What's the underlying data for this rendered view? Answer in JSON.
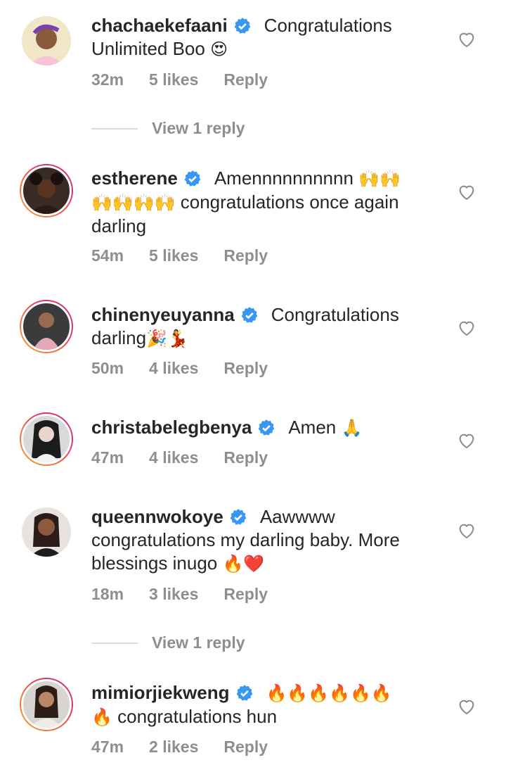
{
  "comments": [
    {
      "username": "chachaekefaani",
      "text": "Congratulations Unlimited Boo",
      "emoji": "😍",
      "time": "32m",
      "likes": "5 likes",
      "reply": "Reply",
      "skin": "#8a5a3c",
      "bg": "#f2e6c8"
    },
    {
      "username": "estherene",
      "text_pre": "Amennnnnnnnnn",
      "emoji_a": "🙌🙌",
      "emoji_b": "🙌🙌🙌🙌",
      "text": "congratulations once again darling",
      "time": "54m",
      "likes": "5 likes",
      "reply": "Reply",
      "skin": "#5a3422",
      "bg": "#3a2a24"
    },
    {
      "username": "chinenyeuyanna",
      "text": "Congratulations darling",
      "emoji": "🎉💃",
      "time": "50m",
      "likes": "4 likes",
      "reply": "Reply",
      "skin": "#9a6a50",
      "bg": "#3b3a3c"
    },
    {
      "username": "christabelegbenya",
      "text": "Amen",
      "emoji": "🙏",
      "time": "47m",
      "likes": "4 likes",
      "reply": "Reply",
      "skin": "#e9d6cc",
      "bg": "#d9d9dc"
    },
    {
      "username": "queennwokoye",
      "text": "Aawwww congratulations my darling baby. More blessings inugo",
      "emoji": "🔥❤️",
      "time": "18m",
      "likes": "3 likes",
      "reply": "Reply",
      "skin": "#8e5a3e",
      "bg": "#e8e3de"
    },
    {
      "username": "mimiorjiekweng",
      "emoji_a": "🔥🔥🔥🔥🔥🔥",
      "emoji_b": "🔥",
      "text": "congratulations hun",
      "time": "47m",
      "likes": "2 likes",
      "reply": "Reply",
      "skin": "#b98668",
      "bg": "#d8d4cf"
    }
  ],
  "view_replies": [
    "View 1 reply",
    "View 1 reply"
  ],
  "colors": {
    "verified": "#3897f0",
    "muted": "#8e8e8e",
    "text": "#262626"
  }
}
